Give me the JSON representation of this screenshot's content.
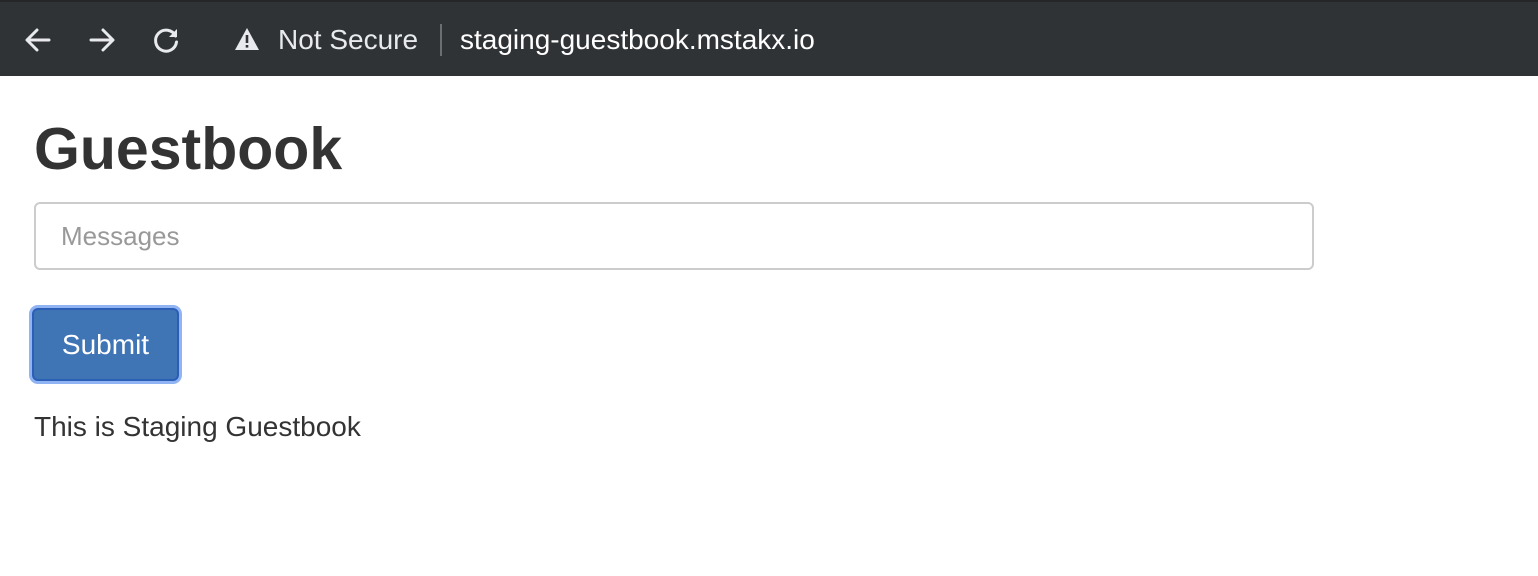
{
  "browser": {
    "security_label": "Not Secure",
    "url": "staging-guestbook.mstakx.io",
    "icons": {
      "back": "back-arrow-icon",
      "forward": "forward-arrow-icon",
      "reload": "reload-icon",
      "security": "warning-triangle-icon"
    }
  },
  "page": {
    "title": "Guestbook",
    "message_input": {
      "placeholder": "Messages",
      "value": ""
    },
    "submit_label": "Submit",
    "footer_text": "This is Staging Guestbook"
  },
  "colors": {
    "toolbar_bg": "#303336",
    "button_bg": "#3f74b5",
    "focus_ring": "#8fb3f3",
    "title_text": "#333333"
  }
}
